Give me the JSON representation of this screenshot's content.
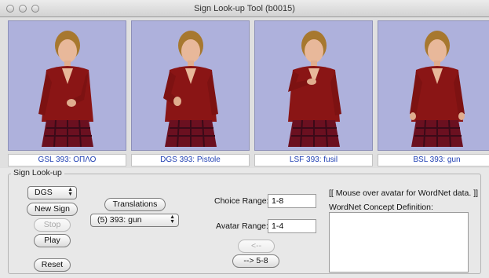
{
  "window": {
    "title": "Sign Look-up Tool (b0015)"
  },
  "panels": [
    {
      "caption": "GSL 393: ΟΠΛΟ"
    },
    {
      "caption": "DGS 393: Pistole"
    },
    {
      "caption": "LSF 393: fusil"
    },
    {
      "caption": "BSL 393: gun"
    }
  ],
  "lookup": {
    "group_title": "Sign Look-up",
    "language_select": "DGS",
    "new_sign_label": "New Sign",
    "stop_label": "Stop",
    "play_label": "Play",
    "reset_label": "Reset",
    "translations_label": "Translations",
    "translation_select": "(5) 393: gun",
    "choice_range_label": "Choice Range:",
    "choice_range_value": "1-8",
    "avatar_range_label": "Avatar Range:",
    "avatar_range_value": "1-4",
    "prev_label": "<--",
    "next_label": "--> 5-8",
    "wordnet_hint": "[[ Mouse over avatar for WordNet data. ]]",
    "wordnet_label": "WordNet Concept Definition:",
    "wordnet_definition": ""
  },
  "colors": {
    "viewport_bg": "#aeb1dc",
    "caption_text": "#1f3fb3",
    "shirt": "#8a1515",
    "hair": "#a7782f"
  }
}
